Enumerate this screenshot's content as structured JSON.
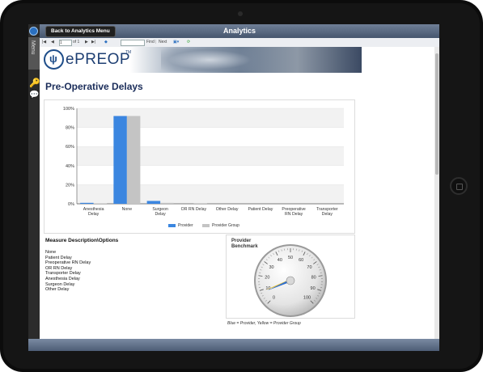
{
  "window": {
    "title": "Analytics"
  },
  "nav": {
    "back_button": "Back to Analytics Menu",
    "rail_menu_label": "Menu"
  },
  "toolbar": {
    "page_value": "1",
    "page_of": "of 1",
    "find_label": "Find",
    "next_label": "Next"
  },
  "banner": {
    "logo_text": "ePREOP",
    "trademark": "TM"
  },
  "report": {
    "title": "Pre-Operative Delays"
  },
  "chart_data": {
    "type": "bar",
    "categories": [
      "Anesthesia Delay",
      "None",
      "Surgeon Delay",
      "OR RN Delay",
      "Other Delay",
      "Patient Delay",
      "Preoperative RN Delay",
      "Transporter Delay"
    ],
    "category_lines": [
      [
        "Anesthesia",
        "Delay"
      ],
      [
        "None"
      ],
      [
        "Surgeon",
        "Delay"
      ],
      [
        "OR RN Delay"
      ],
      [
        "Other Delay"
      ],
      [
        "Patient Delay"
      ],
      [
        "Preoperative",
        "RN Delay"
      ],
      [
        "Transporter",
        "Delay"
      ]
    ],
    "series": [
      {
        "name": "Provider",
        "color": "#3b86e0",
        "values": [
          1,
          92,
          3,
          0,
          0,
          0,
          0,
          0
        ]
      },
      {
        "name": "Provider Group",
        "color": "#c4c4c4",
        "values": [
          0.5,
          92,
          1,
          0.3,
          0,
          0,
          0,
          0
        ]
      }
    ],
    "ytick_labels": [
      "0%",
      "20%",
      "40%",
      "60%",
      "80%",
      "100%"
    ],
    "ylim": [
      0,
      100
    ],
    "grid": true,
    "legend_position": "bottom"
  },
  "measures": {
    "heading": "Measure Description\\Options",
    "items": [
      "None",
      "Patient Delay",
      "Preoperative RN Delay",
      "OR RN Delay",
      "Transporter Delay",
      "Anesthesia Delay",
      "Surgeon Delay",
      "Other Delay"
    ]
  },
  "gauge": {
    "title_line1": "Provider",
    "title_line2": "Benchmark",
    "min": 0,
    "max": 100,
    "tick_labels": [
      "0",
      "10",
      "20",
      "30",
      "40",
      "50",
      "60",
      "70",
      "80",
      "90",
      "100"
    ],
    "provider_value": 8,
    "group_value": 9,
    "provider_color": "#2f6fd0",
    "group_color": "#e8c13a",
    "caption": "Blue = Provider, Yellow = Provider Group"
  }
}
